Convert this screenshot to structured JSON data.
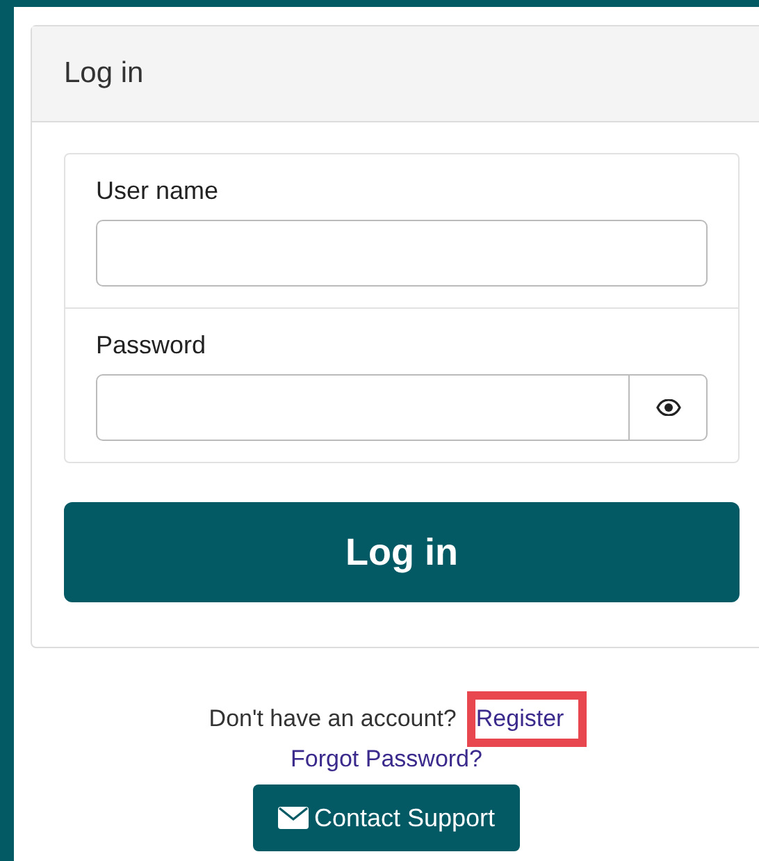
{
  "card": {
    "title": "Log in"
  },
  "fields": [
    {
      "label": "User name",
      "kind": "text"
    },
    {
      "label": "Password",
      "kind": "password"
    }
  ],
  "submit": "Log in",
  "register_prompt": "Don't have an account?",
  "register_link": "Register",
  "forgot_link": "Forgot Password?",
  "support_button": "Contact Support",
  "annotation": {
    "kind": "highlight",
    "color": "#e8474f"
  }
}
